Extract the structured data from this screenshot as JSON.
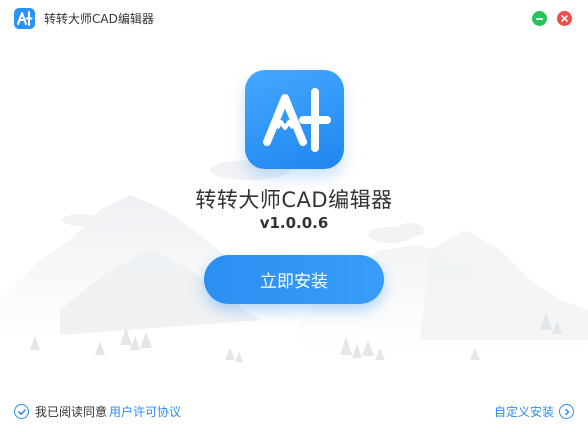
{
  "window": {
    "title": "转转大师CAD编辑器",
    "minimize_icon": "minimize-icon",
    "close_icon": "close-icon"
  },
  "app": {
    "logo_icon": "app-logo-icon",
    "name": "转转大师CAD编辑器",
    "version": "v1.0.0.6"
  },
  "install": {
    "button_label": "立即安装"
  },
  "footer": {
    "agree_text": "我已阅读同意",
    "license_link": "用户许可协议",
    "custom_install": "自定义安装"
  },
  "colors": {
    "accent": "#2a8df0",
    "minimize": "#27c45b",
    "close": "#f34c4c"
  }
}
